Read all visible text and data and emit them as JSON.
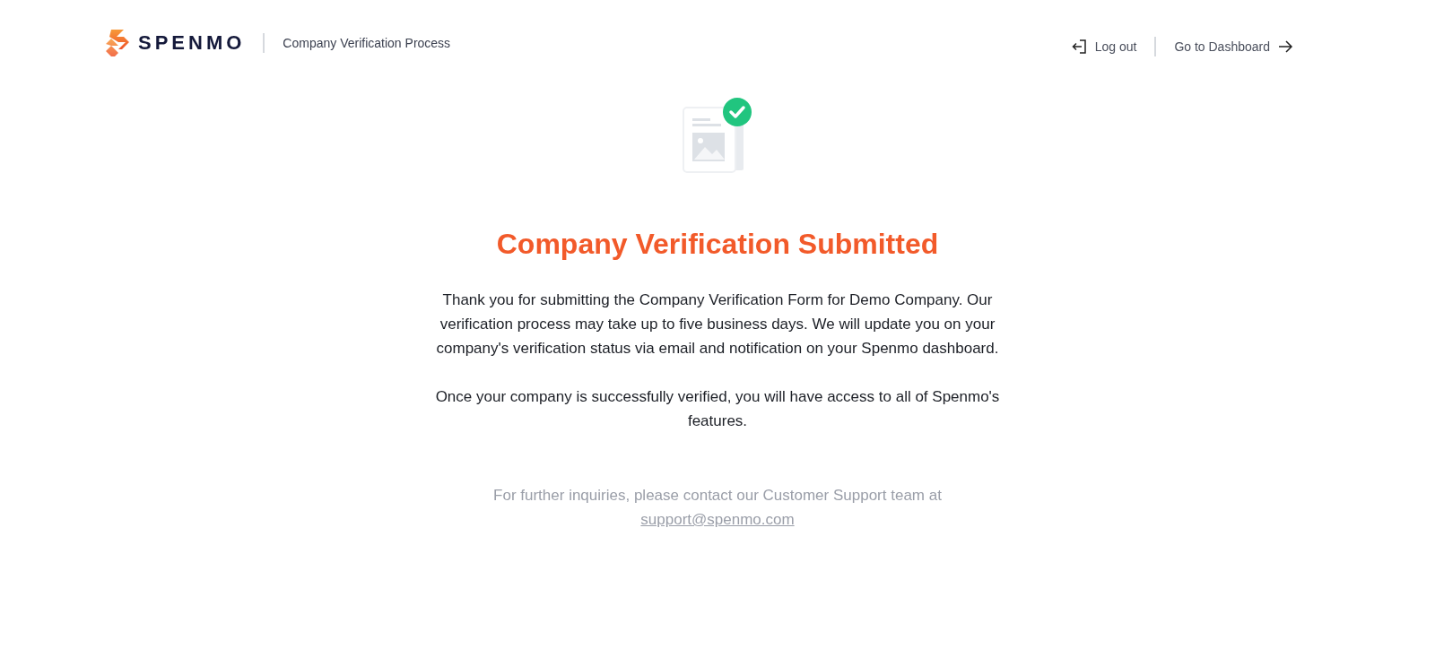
{
  "header": {
    "logo_text": "SPENMO",
    "title": "Company Verification Process",
    "logout": "Log out",
    "dashboard": "Go to Dashboard"
  },
  "main": {
    "title": "Company Verification Submitted",
    "paragraphs": [
      "Thank you for submitting the Company Verification Form for Demo Company. Our verification process may take up to five business days. We will update you on your company's verification status via email and notification on your Spenmo dashboard.",
      "Once your company is successfully verified, you will have access to all of Spenmo's features."
    ],
    "support_text": "For further inquiries, please contact our Customer Support team at",
    "support_email": "support@spenmo.com"
  }
}
